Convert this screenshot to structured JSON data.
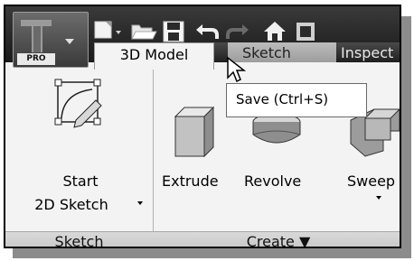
{
  "app": {
    "badge": "PRO"
  },
  "quick_access": {
    "items": [
      "new-icon",
      "open-icon",
      "save-icon",
      "undo-icon",
      "redo-icon",
      "home-icon"
    ]
  },
  "tabs": [
    {
      "label": "3D Model",
      "active": true
    },
    {
      "label": "Sketch",
      "active": false
    },
    {
      "label": "Inspect",
      "active": false
    }
  ],
  "tooltip": {
    "text": "Save (Ctrl+S)"
  },
  "ribbon": {
    "start_sketch": {
      "line1": "Start",
      "line2": "2D Sketch"
    },
    "tools": {
      "extrude": "Extrude",
      "revolve": "Revolve",
      "sweep": "Sweep"
    },
    "panels": {
      "sketch": "Sketch",
      "create": "Create ▼"
    }
  },
  "colors": {
    "title_bar_dark": "#1a1a1a",
    "ribbon_bg": "#f3f3f3",
    "panel_bar": "#cfcfcf"
  }
}
